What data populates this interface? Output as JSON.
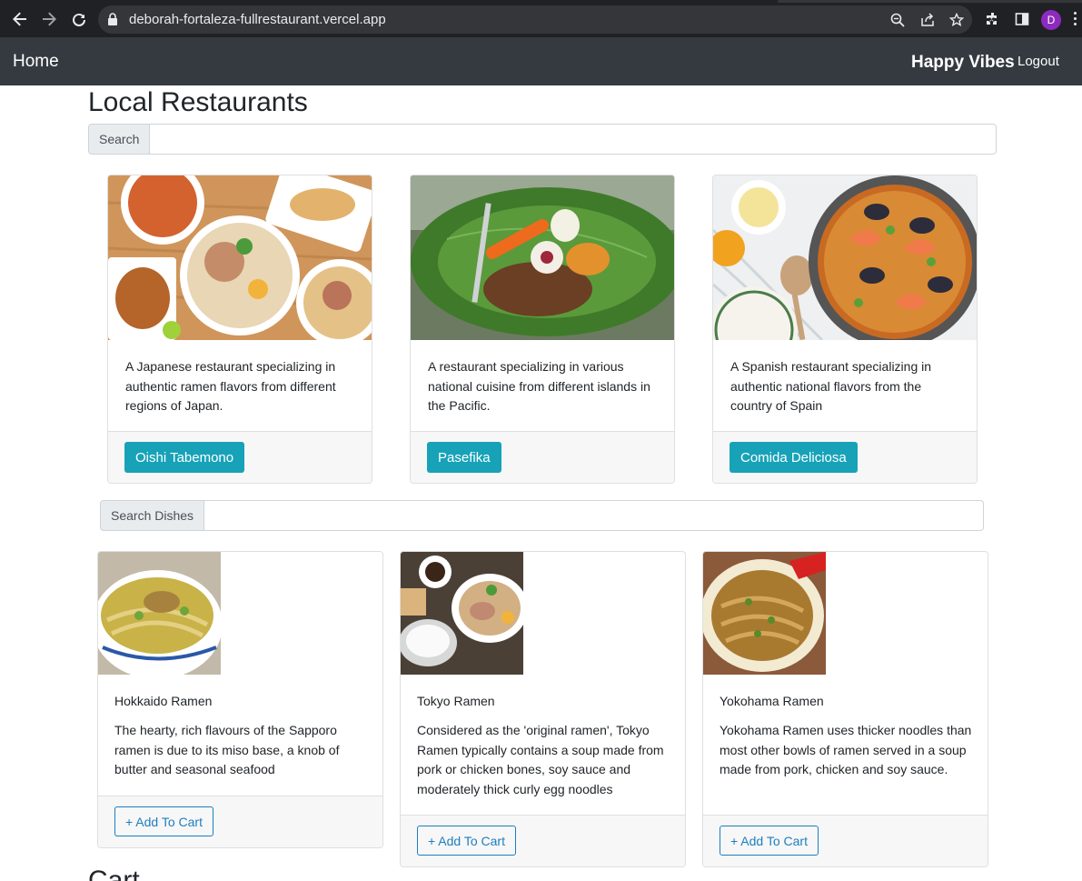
{
  "browser": {
    "url": "deborah-fortaleza-fullrestaurant.vercel.app",
    "profile_initial": "D",
    "icons": [
      "back-arrow-icon",
      "forward-arrow-icon",
      "reload-icon",
      "lock-icon",
      "zoom-icon",
      "share-icon",
      "bookmark-star-icon",
      "extensions-icon",
      "side-panel-icon",
      "menu-kebab-icon"
    ]
  },
  "navbar": {
    "home_label": "Home",
    "user_label": "Happy Vibes",
    "logout_label": "Logout"
  },
  "page": {
    "title": "Local Restaurants",
    "search_label": "Search",
    "search_value": "",
    "dish_search_label": "Search Dishes",
    "dish_search_value": "",
    "cart_heading": "Cart"
  },
  "restaurants": [
    {
      "description": "A Japanese restaurant specializing in authentic ramen flavors from different regions of Japan.",
      "button": "Oishi Tabemono"
    },
    {
      "description": "A restaurant specializing in various national cuisine from different islands in the Pacific.",
      "button": "Pasefika"
    },
    {
      "description": "A Spanish restaurant specializing in authentic national flavors from the country of Spain",
      "button": "Comida Deliciosa"
    }
  ],
  "dishes": [
    {
      "name": "Hokkaido Ramen",
      "description": "The hearty, rich flavours of the Sapporo ramen is due to its miso base, a knob of butter and seasonal seafood",
      "button": "+ Add To Cart"
    },
    {
      "name": "Tokyo Ramen",
      "description": "Considered as the 'original ramen', Tokyo Ramen typically contains a soup made from pork or chicken bones, soy sauce and moderately thick curly egg noodles",
      "button": "+ Add To Cart"
    },
    {
      "name": "Yokohama Ramen",
      "description": "Yokohama Ramen uses thicker noodles than most other bowls of ramen served in a soup made from pork, chicken and soy sauce.",
      "button": "+ Add To Cart"
    }
  ],
  "colors": {
    "navbar": "#343a40",
    "restaurant_button": "#17a2b8",
    "cart_button": "#1b7fc0"
  }
}
